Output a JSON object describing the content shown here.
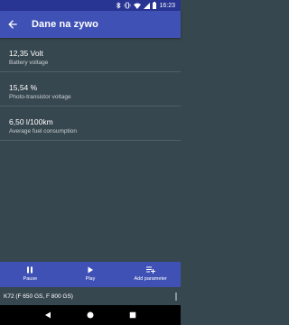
{
  "status_bar": {
    "time": "16:23",
    "icons": [
      "bluetooth-icon",
      "vibrate-icon",
      "wifi-icon",
      "signal-icon",
      "battery-icon"
    ]
  },
  "app_bar": {
    "title": "Dane na zywo",
    "back_icon": "arrow-back-icon"
  },
  "readings": [
    {
      "value": "12,35 Volt",
      "label": "Battery voltage"
    },
    {
      "value": "15,54 %",
      "label": "Photo-transistor voltage"
    },
    {
      "value": "6,50 l/100km",
      "label": "Average fuel consumption"
    }
  ],
  "bottom_bar": {
    "pause_label": "Pause",
    "play_label": "Play",
    "add_label": "Add parameter"
  },
  "device": {
    "name": "K72 (F 650 GS, F 800 GS)"
  },
  "colors": {
    "primary": "#3F51B5",
    "primary_dark": "#283593",
    "background": "#37474F"
  }
}
